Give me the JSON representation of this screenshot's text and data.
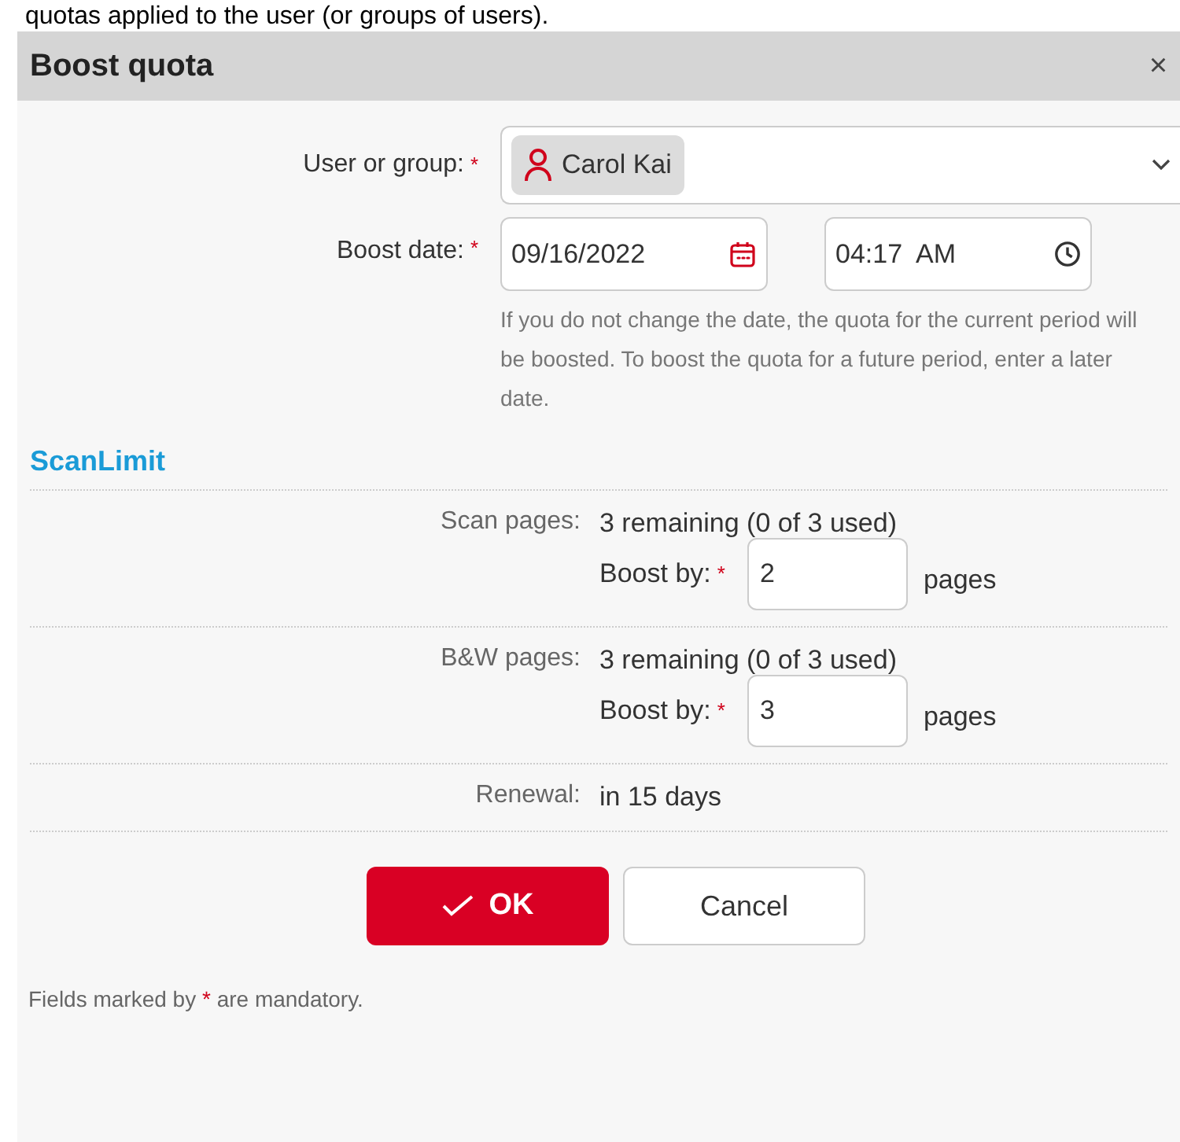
{
  "page_text": "quotas applied to the user (or groups of users).",
  "dialog": {
    "title": "Boost quota",
    "close": "×",
    "user_field": {
      "label": "User or group:",
      "required_mark": "*",
      "value": "Carol Kai"
    },
    "date_field": {
      "label": "Boost date:",
      "required_mark": "*",
      "date": "09/16/2022",
      "time": "04:17  AM",
      "hint": "If you do not change the date, the quota for the current period will be boosted. To boost the quota for a future period, enter a later date."
    },
    "section": {
      "title": "ScanLimit",
      "rows": [
        {
          "kind": "quota",
          "label": "Scan pages:",
          "value": "3 remaining (0 of 3 used)",
          "boost_label": "Boost by:",
          "required_mark": "*",
          "boost_value": "2",
          "unit": "pages"
        },
        {
          "kind": "quota",
          "label": "B&W pages:",
          "value": "3 remaining (0 of 3 used)",
          "boost_label": "Boost by:",
          "required_mark": "*",
          "boost_value": "3",
          "unit": "pages"
        },
        {
          "kind": "plain",
          "label": "Renewal:",
          "value": "in 15 days"
        }
      ]
    },
    "buttons": [
      {
        "kind": "primary",
        "label": "OK"
      },
      {
        "kind": "secondary",
        "label": "Cancel"
      }
    ],
    "footer": {
      "before": "Fields marked by",
      "mark": "*",
      "after": "are mandatory."
    }
  }
}
